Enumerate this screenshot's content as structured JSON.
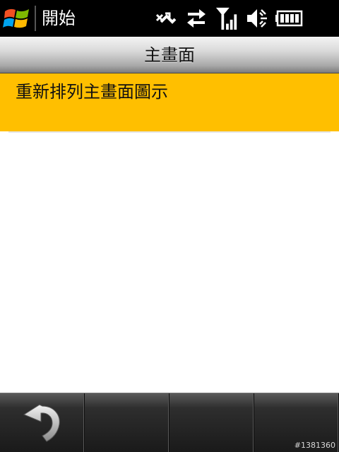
{
  "status_bar": {
    "start_label": "開始",
    "icons": [
      "windows-start-icon",
      "no-sync-icon",
      "data-transfer-icon",
      "signal-strength-icon",
      "speaker-muted-icon",
      "battery-icon"
    ]
  },
  "title_bar": {
    "title": "主畫面"
  },
  "list": {
    "items": [
      {
        "label": "重新排列主畫面圖示",
        "selected": true
      }
    ],
    "selected_color": "#ffbf00"
  },
  "bottom_bar": {
    "softkeys": [
      "back-icon",
      "",
      "",
      ""
    ]
  },
  "watermark": "#1381360"
}
